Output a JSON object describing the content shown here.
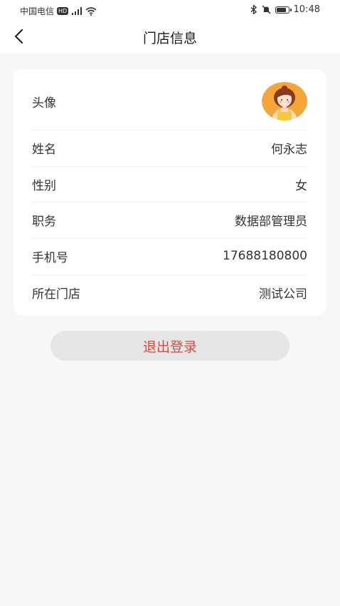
{
  "status_bar": {
    "carrier": "中国电信",
    "network_badge": "HD",
    "time": "10:48",
    "icons": [
      "signal-icon",
      "wifi-icon",
      "bluetooth-icon",
      "mute-icon",
      "battery-icon"
    ]
  },
  "header": {
    "title": "门店信息",
    "back_icon": "chevron-left-icon"
  },
  "profile": {
    "avatar_label": "头像",
    "rows": [
      {
        "label": "姓名",
        "value": "何永志"
      },
      {
        "label": "性别",
        "value": "女"
      },
      {
        "label": "职务",
        "value": "数据部管理员"
      },
      {
        "label": "手机号",
        "value": "17688180800"
      },
      {
        "label": "所在门店",
        "value": "测试公司"
      }
    ]
  },
  "actions": {
    "logout_label": "退出登录"
  },
  "colors": {
    "background": "#f7f7f7",
    "card": "#ffffff",
    "logout_text": "#e0463a",
    "logout_bg": "#e6e6e6",
    "avatar_bg": "#f4a63b"
  }
}
